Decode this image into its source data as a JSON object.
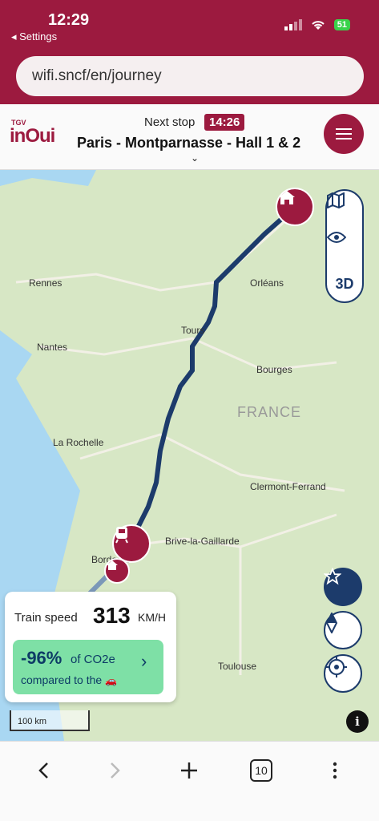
{
  "status_bar": {
    "time": "12:29",
    "back_label": "◂ Settings",
    "battery": "51"
  },
  "browser": {
    "url": "wifi.sncf/en/journey",
    "tab_count": "10"
  },
  "header": {
    "logo_small": "TGV",
    "logo_main": "inOui",
    "next_stop_label": "Next stop",
    "next_stop_time": "14:26",
    "next_stop_name": "Paris - Montparnasse - Hall 1 & 2"
  },
  "map": {
    "country": "FRANCE",
    "places": [
      "Rennes",
      "Orléans",
      "Tours",
      "Nantes",
      "Bourges",
      "La Rochelle",
      "Clermont-Ferrand",
      "Brive-la-Gaillarde",
      "Bordeaux",
      "Toulouse"
    ],
    "controls": {
      "three_d": "3D"
    },
    "scale_label": "100 km"
  },
  "speed_card": {
    "label": "Train speed",
    "value": "313",
    "unit": "KM/H",
    "co2_percent": "-96%",
    "co2_text": "of CO2e",
    "co2_compare": "compared to the"
  },
  "colors": {
    "brand": "#9c1a3f",
    "route": "#1c3b6b",
    "co2_bg": "#7ee0a6"
  }
}
